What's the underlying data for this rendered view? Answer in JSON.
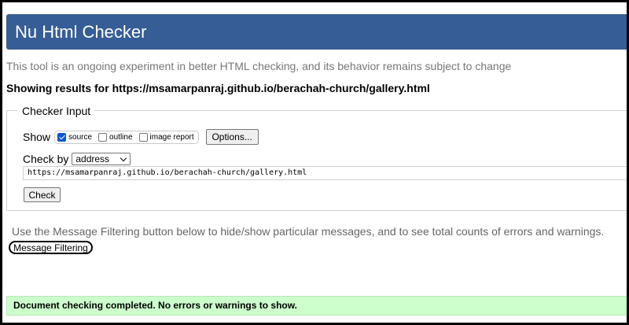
{
  "header": {
    "title": "Nu Html Checker"
  },
  "intro_text": "This tool is an ongoing experiment in better HTML checking, and its behavior remains subject to change",
  "showing_results": "Showing results for https://msamarpanraj.github.io/berachah-church/gallery.html",
  "checker_input": {
    "legend": "Checker Input",
    "show_label": "Show",
    "options": [
      {
        "label": "source",
        "checked": true
      },
      {
        "label": "outline",
        "checked": false
      },
      {
        "label": "image report",
        "checked": false
      }
    ],
    "options_button": "Options...",
    "check_by_label": "Check by",
    "check_by_value": "address",
    "url_value": "https://msamarpanraj.github.io/berachah-church/gallery.html",
    "check_button": "Check"
  },
  "filter_text": "Use the Message Filtering button below to hide/show particular messages, and to see total counts of errors and warnings.",
  "filter_button": "Message Filtering",
  "status_message": "Document checking completed. No errors or warnings to show.",
  "colors": {
    "header_bg": "#365d95",
    "status_bg": "#ccffcc"
  }
}
